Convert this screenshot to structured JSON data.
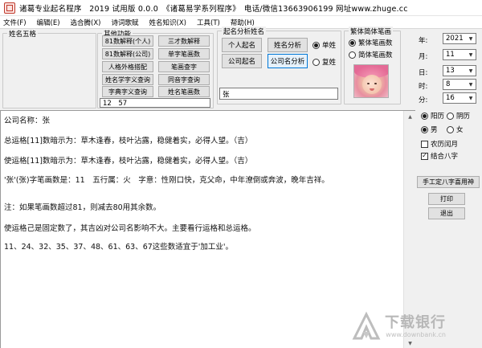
{
  "window": {
    "title": "诸葛专业起名程序　2019 试用版 0.0.0　《诸葛易学系列程序》　电话/微信13663906199 网址www.zhuge.cc"
  },
  "menu": [
    "文件(F)",
    "编辑(E)",
    "选合腾(X)",
    "诗词歌赋",
    "姓名知识(X)",
    "工具(T)",
    "帮助(H)"
  ],
  "left_group": {
    "label": "姓名五格"
  },
  "tools_group": {
    "label": "其他功能",
    "buttons": [
      "81数解释(个人)",
      "三才数解释",
      "81数解释(公司)",
      "单字笔画数",
      "人格外格搭配",
      "笔画查字",
      "姓名学字义查询",
      "同音字查询",
      "字典字义查询",
      "姓名笔画数"
    ],
    "output": "12　57"
  },
  "analysis_group": {
    "label": "起名分析姓名",
    "buttons": [
      "个人起名",
      "姓名分析",
      "公司起名",
      "公司名分析"
    ],
    "radio_single": "单姓",
    "radio_double": "复姓",
    "name_input": "张"
  },
  "stroke_group": {
    "label": "繁体简体笔画",
    "traditional": "繁体笔画数",
    "simplified": "简体笔画数"
  },
  "datetime": {
    "year_label": "年:",
    "year": "2021",
    "month_label": "月:",
    "month": "11",
    "day_label": "日:",
    "day": "13",
    "hour_label": "时:",
    "hour": "8",
    "minute_label": "分:",
    "minute": "16"
  },
  "calendar": {
    "solar": "阳历",
    "lunar": "阴历"
  },
  "gender": {
    "male": "男",
    "female": "女"
  },
  "options": {
    "lunar_leap": "农历闰月",
    "bazi": "结合八字"
  },
  "actions": {
    "manual_bazi": "手工定八字喜用神",
    "print": "打印",
    "exit": "退出"
  },
  "content_lines": [
    "公司名称：张",
    "总运格[11]数暗示为：草木逢春，枝叶沾露，稳健着实，必得人望。（吉）",
    "使运格[11]数暗示为：草木逢春，枝叶沾露，稳健着实，必得人望。（吉）",
    "'张'(张)字笔画数是：11　五行属：火　字意：性刚口快，克父命，中年潦倒或奔波，晚年吉祥。",
    "注：如果笔画数超过81，则减去80用其余数。",
    "使运格己是固定数了，其吉凶对公司名影响不大。主要看行运格和总运格。",
    "11、24、32、35、37、48、61、63、67这些数适宜于'加工业'。"
  ],
  "watermark": {
    "main": "下载银行",
    "sub": "www.downbank.cn"
  }
}
